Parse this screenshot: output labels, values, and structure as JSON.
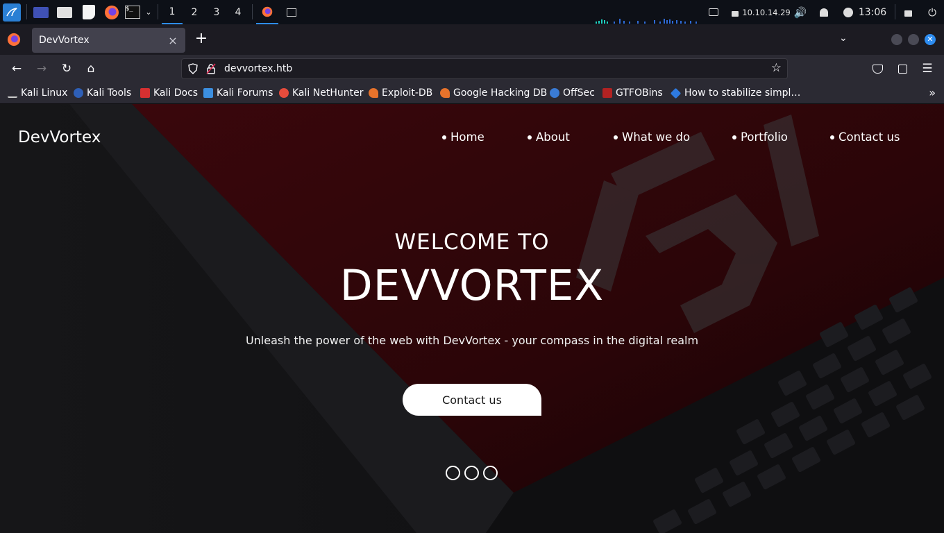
{
  "panel": {
    "workspaces": [
      "1",
      "2",
      "3",
      "4"
    ],
    "ip": "10.10.14.29",
    "time": "13:06"
  },
  "browser": {
    "tab_title": "DevVortex",
    "tab_close": "×",
    "new_tab": "+",
    "url": "devvortex.htb",
    "bookmarks": [
      {
        "label": "Kali Linux",
        "icon": "kali-dragon-icon",
        "color": "#3a7bd5"
      },
      {
        "label": "Kali Tools",
        "icon": "kali-tools-icon",
        "color": "#2e5fb7"
      },
      {
        "label": "Kali Docs",
        "icon": "kali-docs-icon",
        "color": "#d63031"
      },
      {
        "label": "Kali Forums",
        "icon": "kali-forums-icon",
        "color": "#3c8fe0"
      },
      {
        "label": "Kali NetHunter",
        "icon": "nethunter-icon",
        "color": "#e74c3c"
      },
      {
        "label": "Exploit-DB",
        "icon": "exploit-db-icon",
        "color": "#e8732b"
      },
      {
        "label": "Google Hacking DB",
        "icon": "ghdb-icon",
        "color": "#e8732b"
      },
      {
        "label": "OffSec",
        "icon": "offsec-icon",
        "color": "#3a7bd5"
      },
      {
        "label": "GTFOBins",
        "icon": "gtfobins-icon",
        "color": "#b22222"
      },
      {
        "label": "How to stabilize simpl…",
        "icon": "blue-diamond-icon",
        "color": "#2e7ae0"
      }
    ]
  },
  "site": {
    "brand": "DevVortex",
    "nav": [
      "Home",
      "About",
      "What we do",
      "Portfolio",
      "Contact us"
    ],
    "welcome": "WELCOME TO",
    "title": "DEVVORTEX",
    "tagline": "Unleash the power of the web with DevVortex - your compass in the digital realm",
    "cta": "Contact us",
    "slider_dots": 3
  },
  "colors": {
    "accent": "#2d8cf0",
    "hero_red": "#4a0b10",
    "page_bg": "#141416"
  }
}
